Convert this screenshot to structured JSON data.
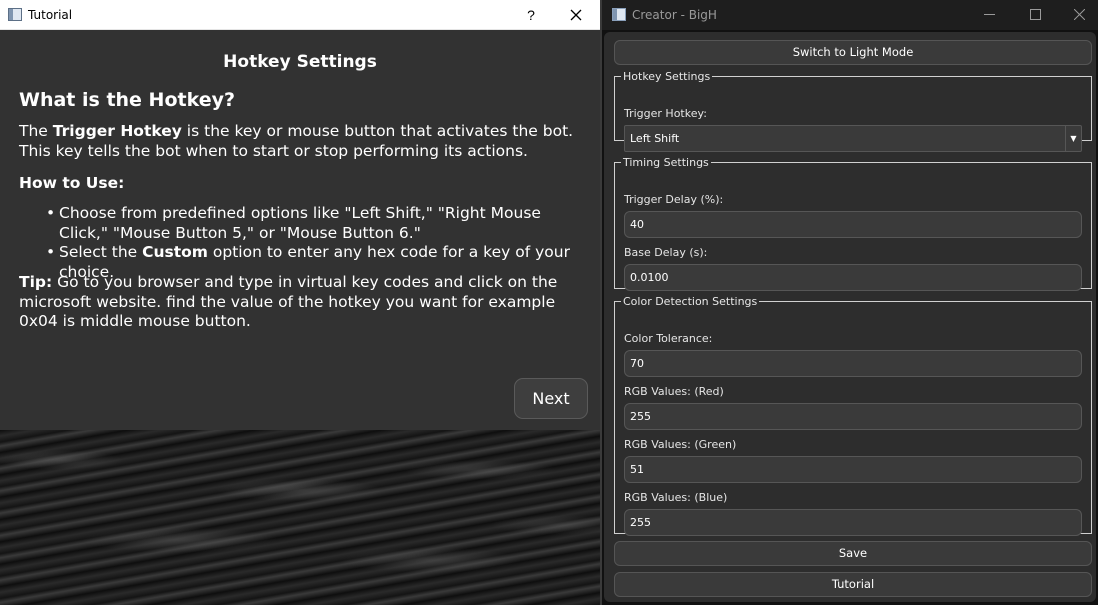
{
  "tutorial": {
    "window_title": "Tutorial",
    "help_symbol": "?",
    "close_symbol": "✕",
    "heading": "Hotkey Settings",
    "section_title": "What is the Hotkey?",
    "intro_prefix": "The ",
    "intro_bold": "Trigger Hotkey",
    "intro_suffix": " is the key or mouse button that activates the bot. This key tells the bot when to start or stop performing its actions.",
    "how_to_title": "How to Use:",
    "bullet1": "Choose from predefined options like \"Left Shift,\" \"Right Mouse Click,\" \"Mouse Button 5,\" or \"Mouse Button 6.\"",
    "bullet2_prefix": "Select the ",
    "bullet2_bold": "Custom",
    "bullet2_suffix": " option to enter any hex code for a key of your choice.",
    "tip_label": "Tip:",
    "tip_text": " Go to you browser and type in virtual key codes and click on the microsoft website. find the value of the hotkey you want for example 0x04 is middle mouse button.",
    "next_label": "Next"
  },
  "creator": {
    "window_title": "Creator - BigH",
    "minimize_symbol": "—",
    "maximize_symbol": "☐",
    "close_symbol": "✕",
    "theme_button": "Switch to Light Mode",
    "hotkey_group": {
      "title": "Hotkey Settings",
      "trigger_label": "Trigger Hotkey:",
      "trigger_value": "Left Shift"
    },
    "timing_group": {
      "title": "Timing Settings",
      "trigger_delay_label": "Trigger Delay (%):",
      "trigger_delay_value": "40",
      "base_delay_label": "Base Delay (s):",
      "base_delay_value": "0.0100"
    },
    "color_group": {
      "title": "Color Detection Settings",
      "tolerance_label": "Color Tolerance:",
      "tolerance_value": "70",
      "red_label": "RGB Values: (Red)",
      "red_value": "255",
      "green_label": "RGB Values: (Green)",
      "green_value": "51",
      "blue_label": "RGB Values: (Blue)",
      "blue_value": "255"
    },
    "save_button": "Save",
    "tutorial_button": "Tutorial"
  }
}
